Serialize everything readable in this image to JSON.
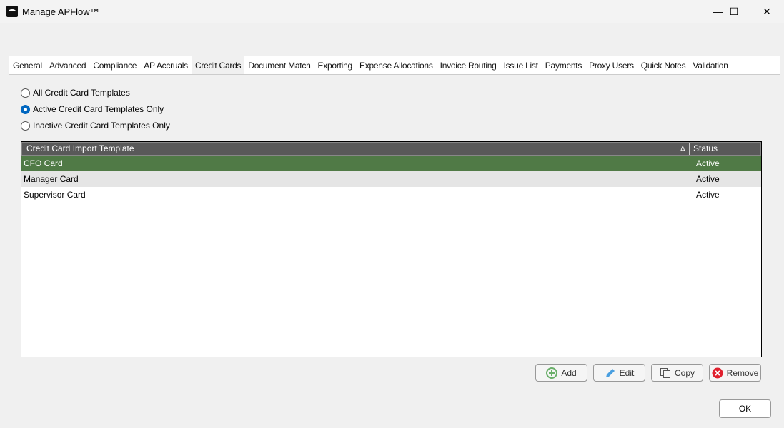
{
  "window": {
    "title": "Manage APFlow™",
    "minimize": "—",
    "maximize": "☐",
    "close": "✕"
  },
  "tabs": [
    "General",
    "Advanced",
    "Compliance",
    "AP Accruals",
    "Credit Cards",
    "Document Match",
    "Exporting",
    "Expense Allocations",
    "Invoice Routing",
    "Issue List",
    "Payments",
    "Proxy Users",
    "Quick Notes",
    "Validation"
  ],
  "active_tab": "Credit Cards",
  "filters": [
    {
      "label": "All Credit Card Templates",
      "checked": false
    },
    {
      "label": "Active Credit Card Templates Only",
      "checked": true
    },
    {
      "label": "Inactive Credit Card Templates Only",
      "checked": false
    }
  ],
  "grid": {
    "columns": [
      "Credit Card Import Template",
      "Status"
    ],
    "sort_indicator": "∆",
    "rows": [
      {
        "name": "CFO Card",
        "status": "Active"
      },
      {
        "name": "Manager Card",
        "status": "Active"
      },
      {
        "name": "Supervisor Card",
        "status": "Active"
      }
    ]
  },
  "buttons": {
    "add": "Add",
    "edit": "Edit",
    "copy": "Copy",
    "remove": "Remove",
    "ok": "OK"
  },
  "colors": {
    "selected_row": "#507a46",
    "header": "#595959",
    "accent": "#0067c0"
  }
}
